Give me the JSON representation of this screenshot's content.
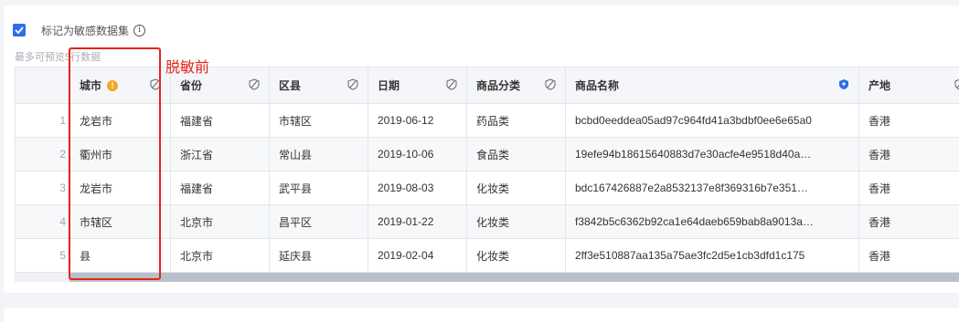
{
  "sensitive_checkbox": {
    "label": "标记为敏感数据集",
    "checked": true,
    "icon": "info-icon"
  },
  "preview_note": "最多可预览5行数据",
  "annotation_label": "脱敏前",
  "colors": {
    "accent": "#2f6ee8",
    "annotation": "#e8231a",
    "warning": "#f5a623"
  },
  "table": {
    "columns": [
      {
        "label": "城市",
        "icon": "shield-slash-icon",
        "warning": true
      },
      {
        "label": "省份",
        "icon": "shield-slash-icon"
      },
      {
        "label": "区县",
        "icon": "shield-slash-icon"
      },
      {
        "label": "日期",
        "icon": "shield-slash-icon"
      },
      {
        "label": "商品分类",
        "icon": "shield-slash-icon"
      },
      {
        "label": "商品名称",
        "icon": "shield-filled-icon"
      },
      {
        "label": "产地",
        "icon": "shield-slash-icon"
      }
    ],
    "rows": [
      {
        "index": "1",
        "cells": [
          "龙岩市",
          "福建省",
          "市辖区",
          "2019-06-12",
          "药品类",
          "bcbd0eeddea05ad97c964fd41a3bdbf0ee6e65a0",
          "香港"
        ]
      },
      {
        "index": "2",
        "cells": [
          "衢州市",
          "浙江省",
          "常山县",
          "2019-10-06",
          "食品类",
          "19efe94b18615640883d7e30acfe4e9518d40a…",
          "香港"
        ]
      },
      {
        "index": "3",
        "cells": [
          "龙岩市",
          "福建省",
          "武平县",
          "2019-08-03",
          "化妆类",
          "bdc167426887e2a8532137e8f369316b7e351…",
          "香港"
        ]
      },
      {
        "index": "4",
        "cells": [
          "市辖区",
          "北京市",
          "昌平区",
          "2019-01-22",
          "化妆类",
          "f3842b5c6362b92ca1e64daeb659bab8a9013a…",
          "香港"
        ]
      },
      {
        "index": "5",
        "cells": [
          "县",
          "北京市",
          "延庆县",
          "2019-02-04",
          "化妆类",
          "2ff3e510887aa135a75ae3fc2d5e1cb3dfd1c175",
          "香港"
        ]
      }
    ]
  }
}
